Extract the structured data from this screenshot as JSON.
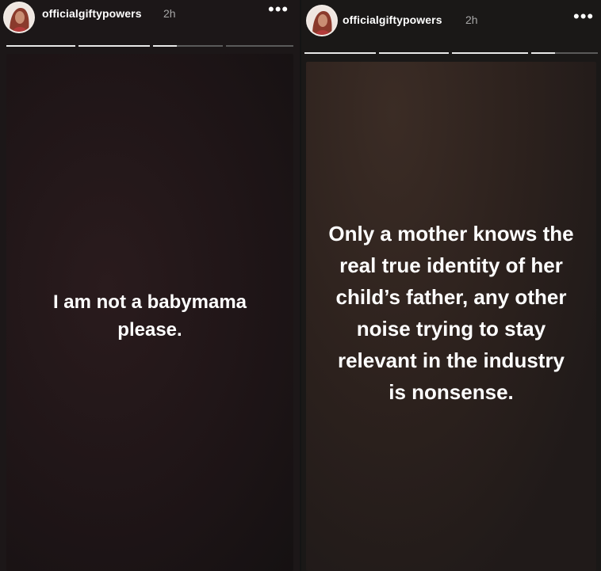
{
  "stories": [
    {
      "username": "officialgiftypowers",
      "time": "2h",
      "more_icon": "more-options-icon",
      "text": "I am not a babymama please."
    },
    {
      "username": "officialgiftypowers",
      "time": "2h",
      "more_icon": "more-options-icon",
      "text": "Only a mother knows the real true identity of her child’s father, any other noise trying to stay relevant in the industry is nonsense."
    }
  ],
  "ui": {
    "more_glyph": "•••"
  },
  "colors": {
    "progress_done": "#e8e8e8",
    "progress_pending": "#5a5a5a",
    "text": "#ffffff"
  }
}
